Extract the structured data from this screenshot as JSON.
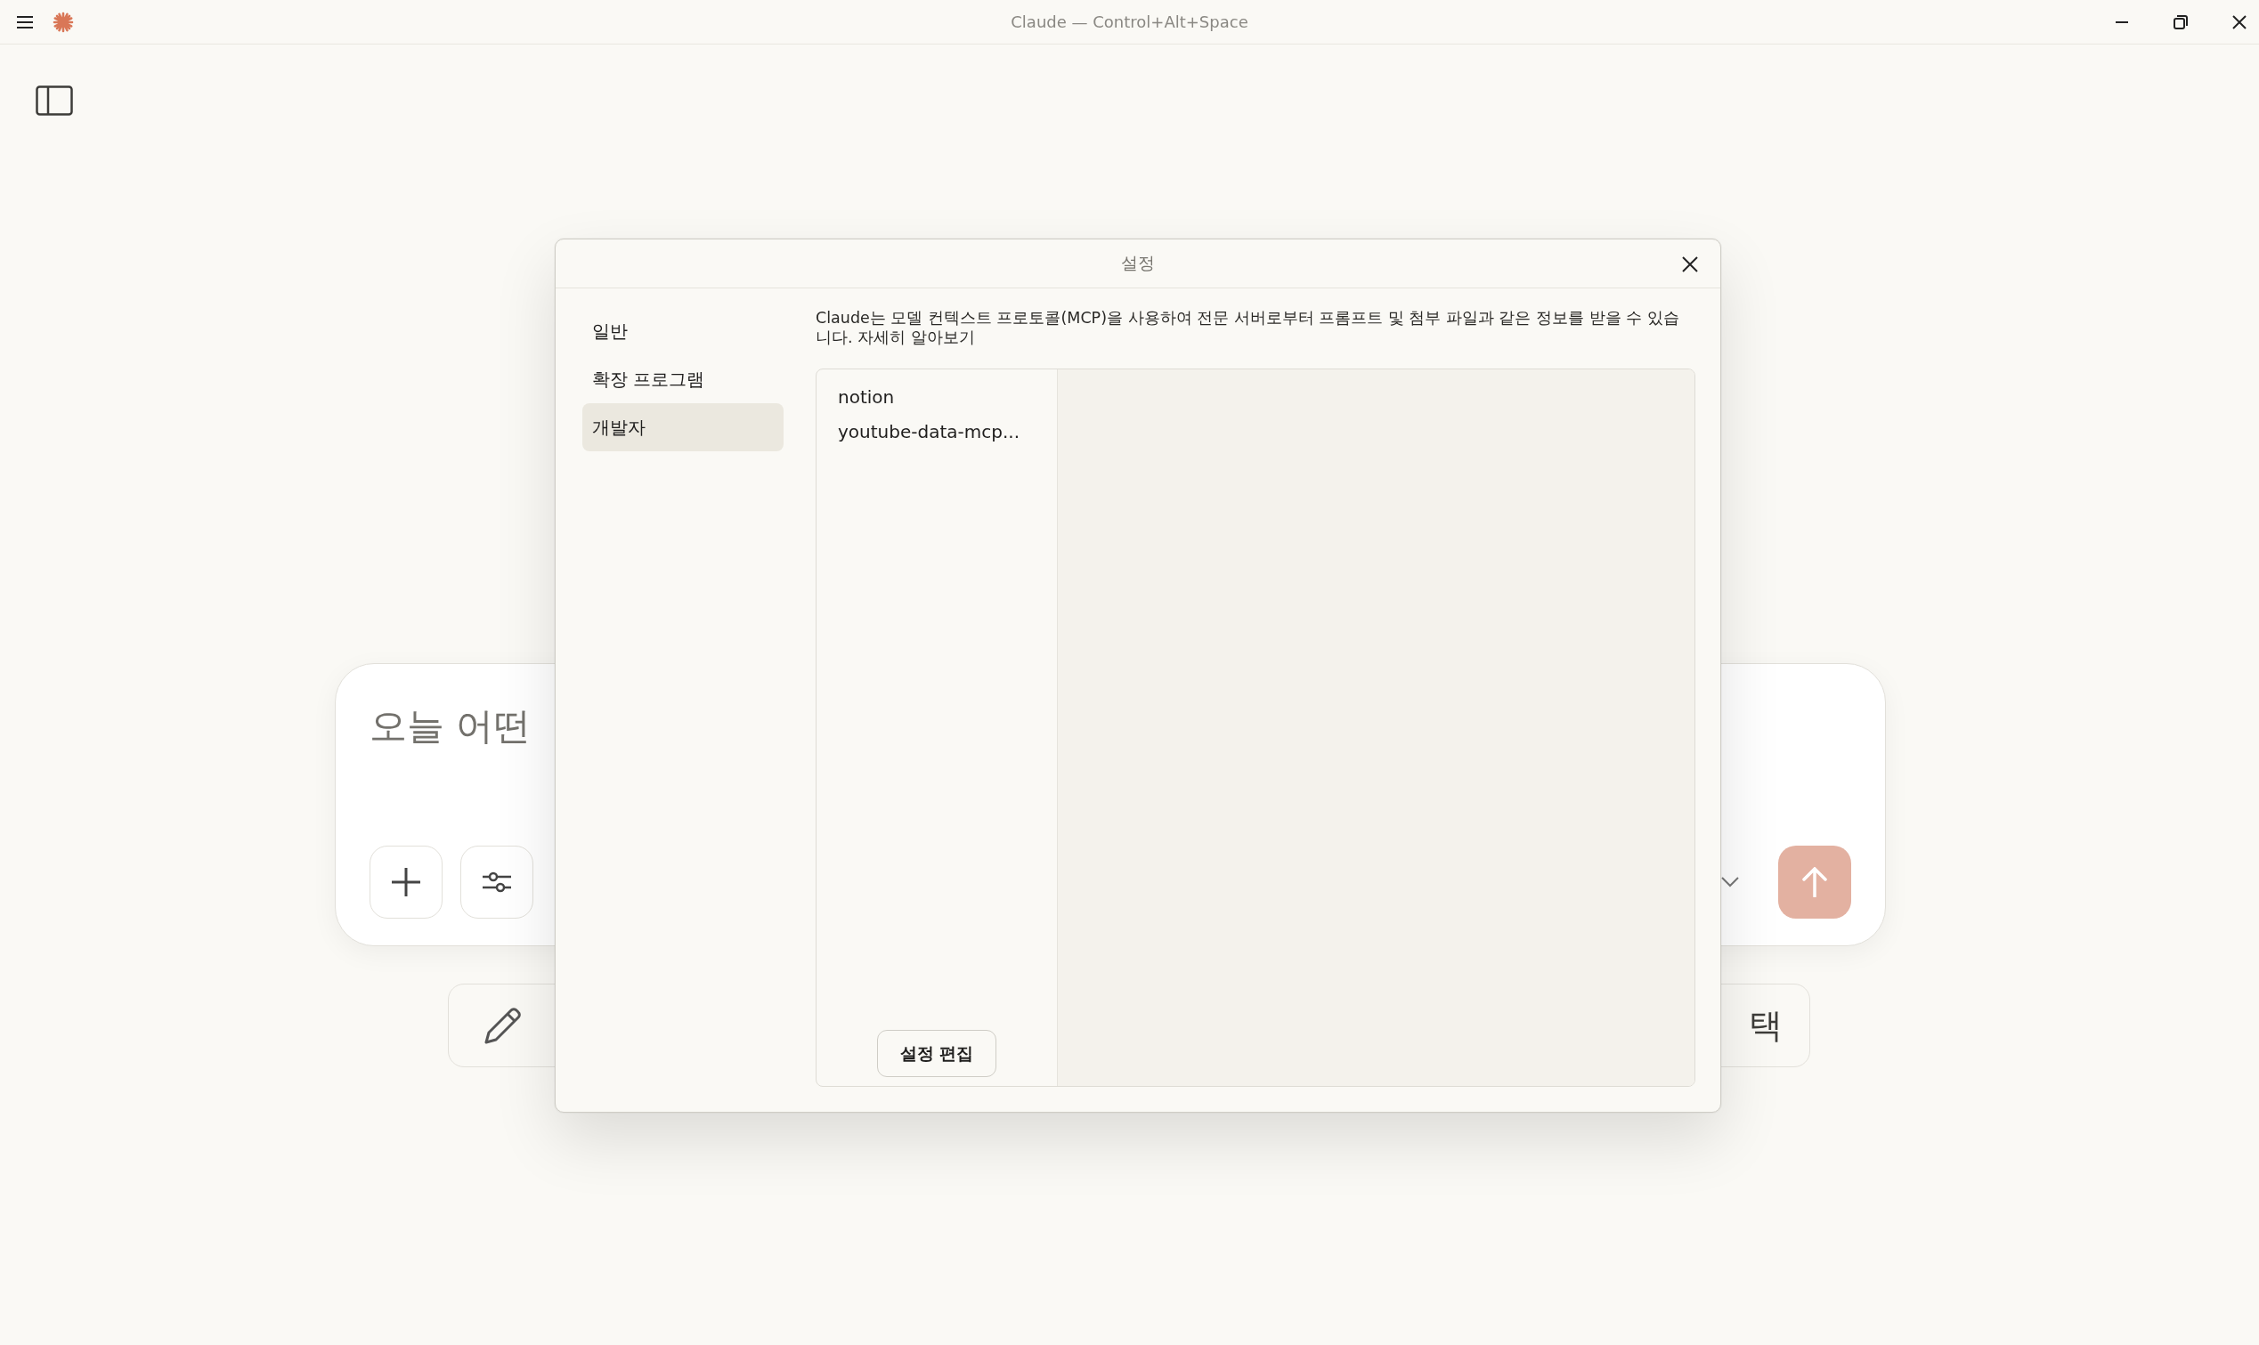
{
  "window": {
    "title": "Claude — Control+Alt+Space"
  },
  "composer": {
    "placeholder": "오늘 어떤",
    "send_enabled": false
  },
  "suggestions": {
    "last_label": "택"
  },
  "settings_dialog": {
    "title": "설정",
    "nav": [
      {
        "label": "일반",
        "selected": false
      },
      {
        "label": "확장 프로그램",
        "selected": false
      },
      {
        "label": "개발자",
        "selected": true
      }
    ],
    "description": "Claude는 모델 컨텍스트 프로토콜(MCP)을 사용하여 전문 서버로부터 프롬프트 및 첨부 파일과 같은 정보를 받을 수 있습니다. 자세히 알아보기",
    "servers": [
      {
        "name": "notion"
      },
      {
        "name": "youtube-data-mcp..."
      }
    ],
    "edit_button": "설정 편집"
  }
}
